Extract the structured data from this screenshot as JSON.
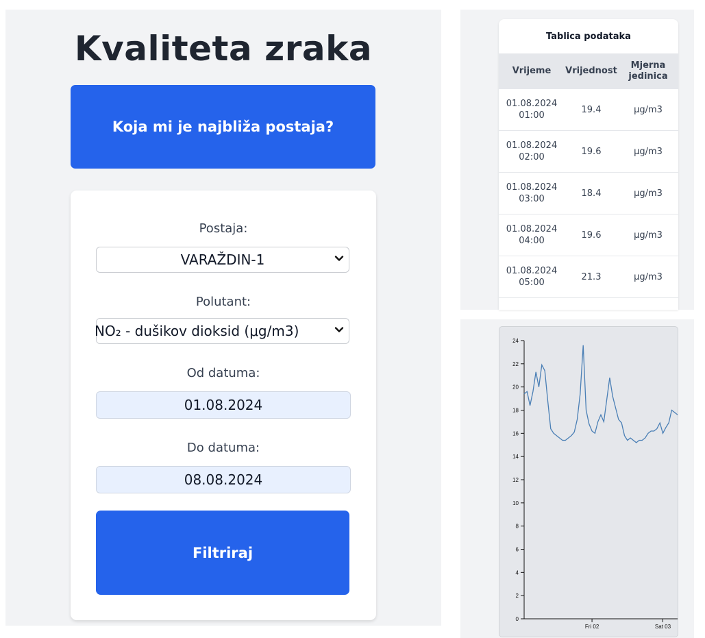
{
  "app": {
    "title": "Kvaliteta zraka",
    "nearest_button": "Koja mi je najbliža postaja?"
  },
  "form": {
    "station_label": "Postaja:",
    "station_value": "VARAŽDIN-1",
    "pollutant_label": "Polutant:",
    "pollutant_value": "NO₂ - dušikov dioksid (μg/m3)",
    "from_label": "Od datuma:",
    "from_value": "01.08.2024",
    "to_label": "Do datuma:",
    "to_value": "08.08.2024",
    "filter_button": "Filtriraj"
  },
  "table": {
    "title": "Tablica podataka",
    "headers": [
      "Vrijeme",
      "Vrijednost",
      "Mjerna jedinica"
    ],
    "rows": [
      {
        "time": "01.08.2024 01:00",
        "value": "19.4",
        "unit": "μg/m3"
      },
      {
        "time": "01.08.2024 02:00",
        "value": "19.6",
        "unit": "μg/m3"
      },
      {
        "time": "01.08.2024 03:00",
        "value": "18.4",
        "unit": "μg/m3"
      },
      {
        "time": "01.08.2024 04:00",
        "value": "19.6",
        "unit": "μg/m3"
      },
      {
        "time": "01.08.2024 05:00",
        "value": "21.3",
        "unit": "μg/m3"
      }
    ]
  },
  "chart_data": {
    "type": "line",
    "ylim": [
      0,
      24
    ],
    "yticks": [
      0,
      2,
      4,
      6,
      8,
      10,
      12,
      14,
      16,
      18,
      20,
      22,
      24
    ],
    "xticks": [
      {
        "label": "Fri 02",
        "x": 24
      },
      {
        "label": "Sat 03",
        "x": 48
      }
    ],
    "xlim": [
      1,
      53
    ],
    "line_color": "#4a7fb5",
    "x": [
      1,
      2,
      3,
      4,
      5,
      6,
      7,
      8,
      9,
      10,
      11,
      12,
      13,
      14,
      15,
      16,
      17,
      18,
      19,
      20,
      21,
      22,
      23,
      24,
      25,
      26,
      27,
      28,
      29,
      30,
      31,
      32,
      33,
      34,
      35,
      36,
      37,
      38,
      39,
      40,
      41,
      42,
      43,
      44,
      45,
      46,
      47,
      48,
      49,
      50,
      51,
      52,
      53
    ],
    "values": [
      19.4,
      19.6,
      18.4,
      19.6,
      21.3,
      20.0,
      21.9,
      21.4,
      18.8,
      16.4,
      16.0,
      15.8,
      15.6,
      15.4,
      15.4,
      15.6,
      15.8,
      16.1,
      17.2,
      19.4,
      23.6,
      18.0,
      16.8,
      16.2,
      16.0,
      17.0,
      17.6,
      17.0,
      18.9,
      20.8,
      19.2,
      18.2,
      17.2,
      16.9,
      15.8,
      15.4,
      15.6,
      15.4,
      15.2,
      15.4,
      15.4,
      15.6,
      16.0,
      16.2,
      16.2,
      16.4,
      16.9,
      16.0,
      16.5,
      16.9,
      18.0,
      17.8,
      17.6
    ]
  }
}
